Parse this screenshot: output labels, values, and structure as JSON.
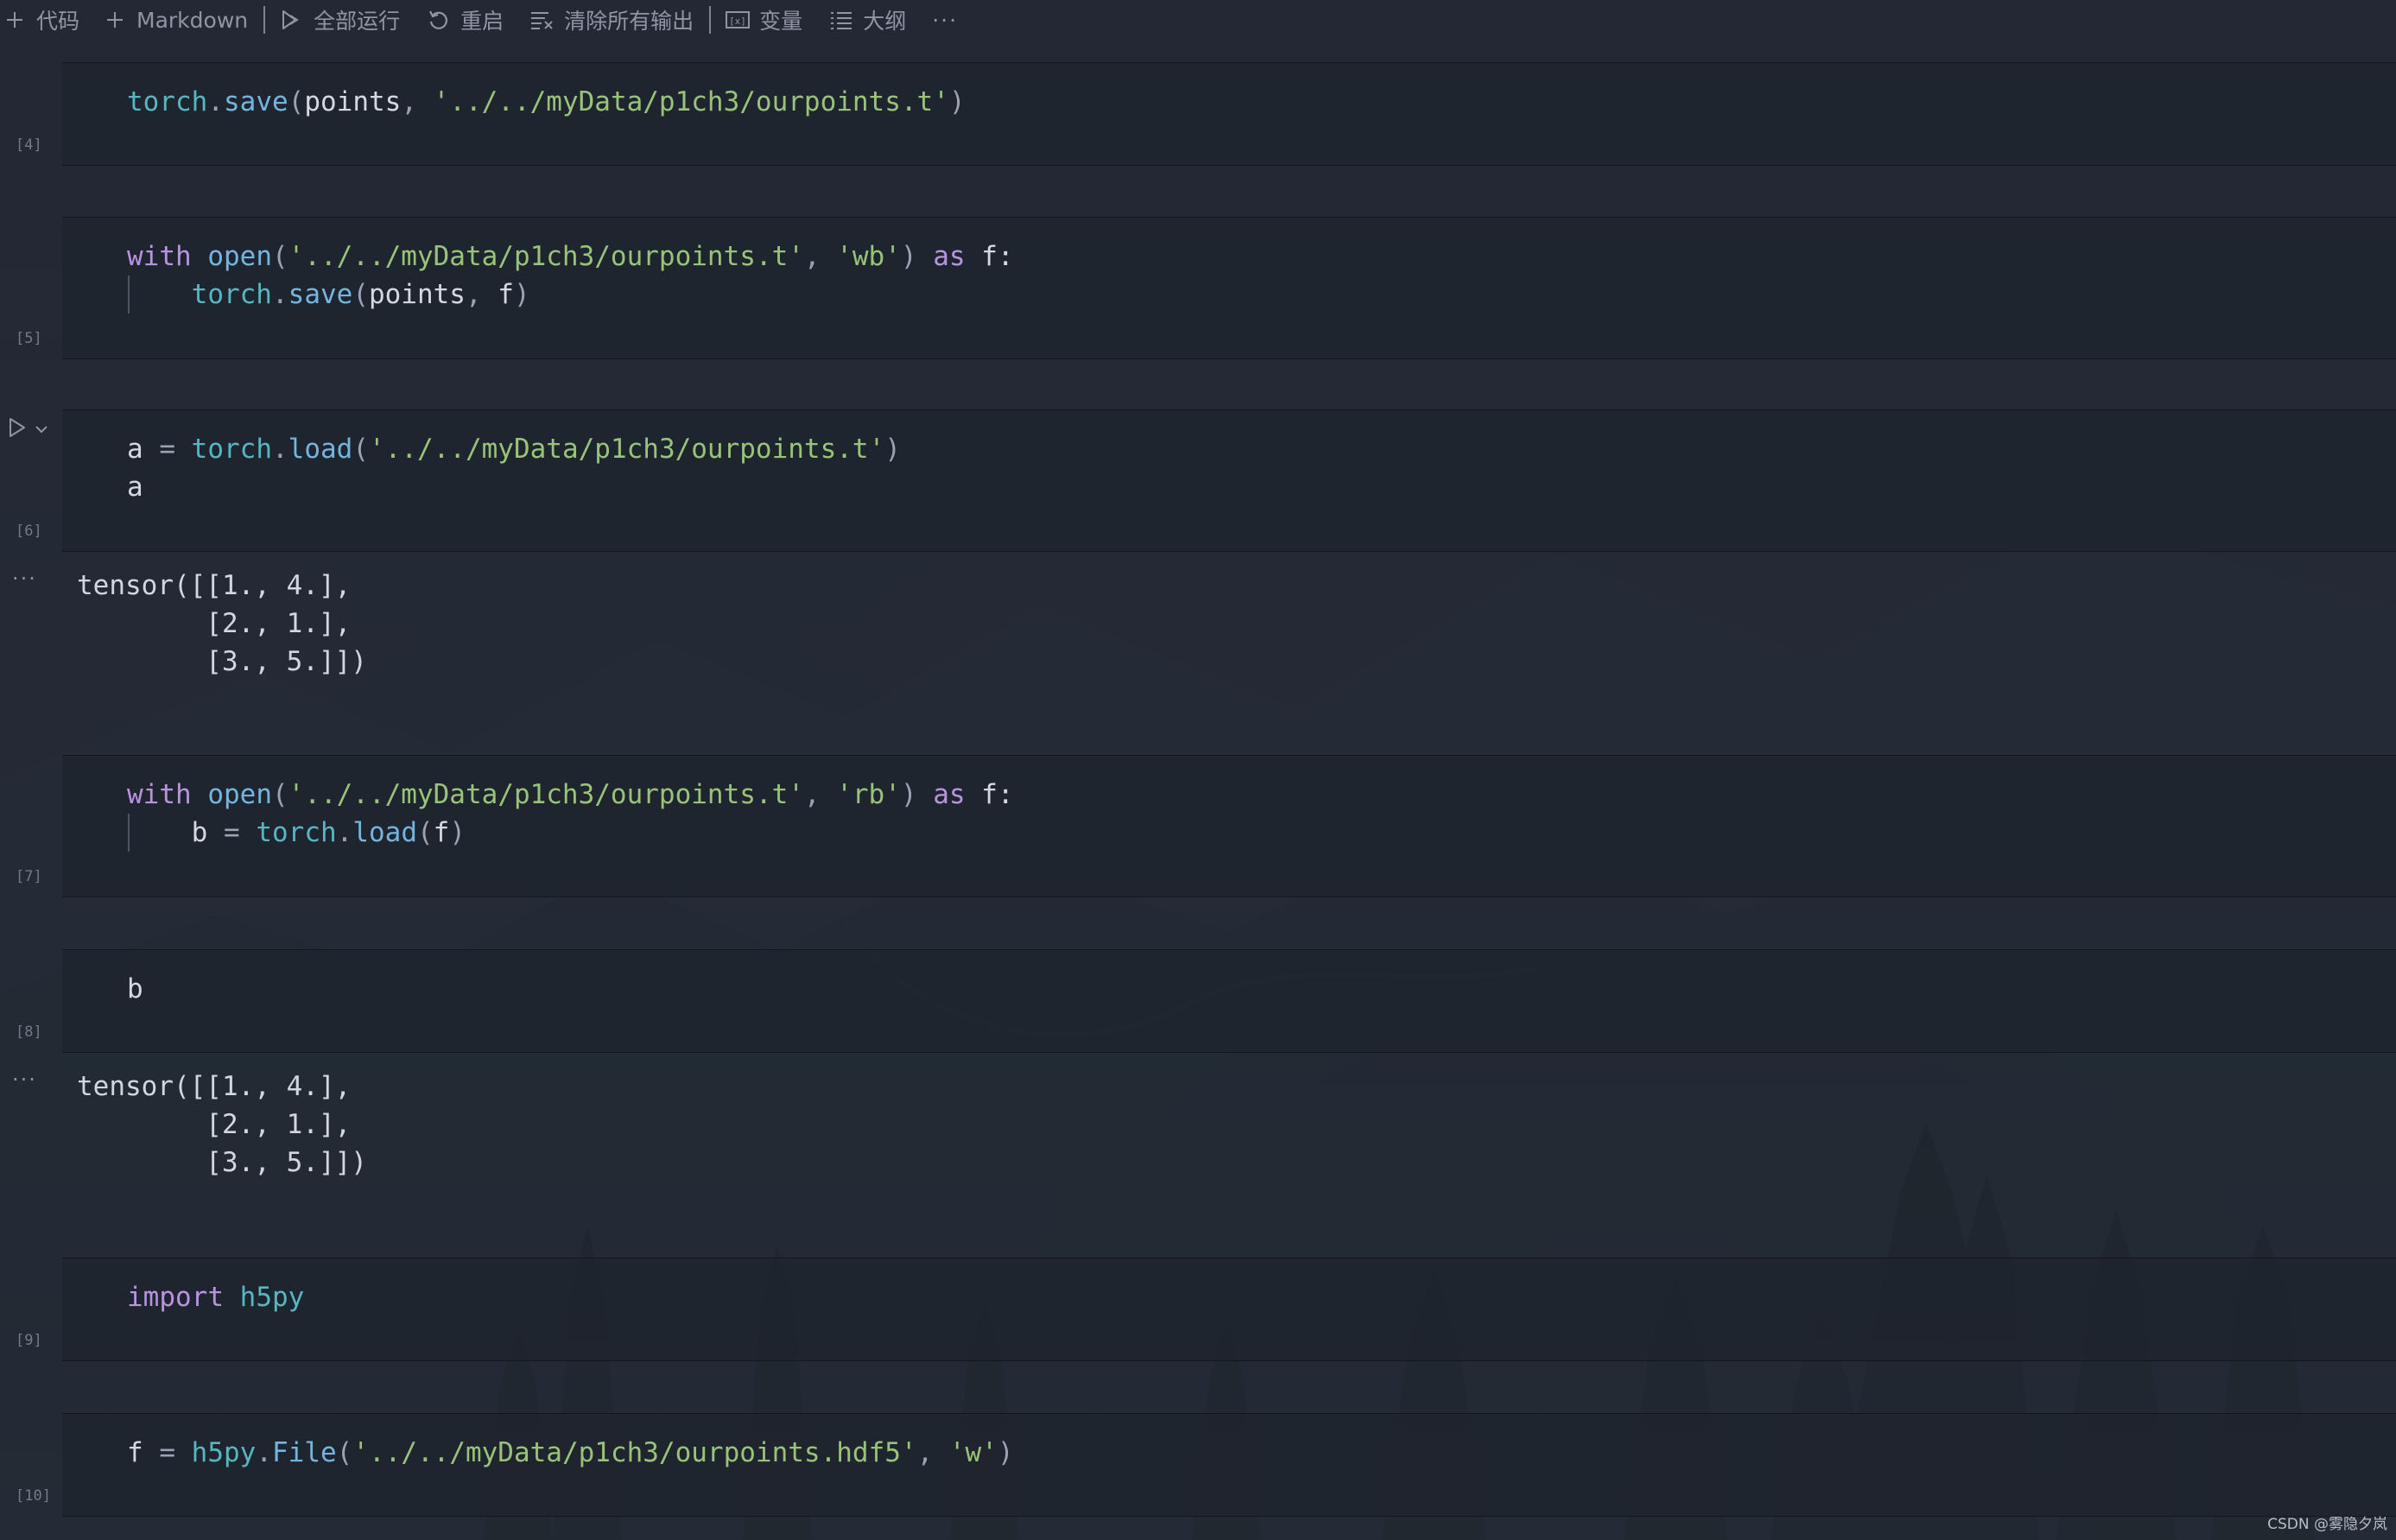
{
  "toolbar": {
    "add_code_label": "代码",
    "add_markdown_label": "Markdown",
    "run_all_label": "全部运行",
    "restart_label": "重启",
    "clear_outputs_label": "清除所有输出",
    "variables_label": "变量",
    "outline_label": "大纲",
    "more_label": "···"
  },
  "cells": [
    {
      "count": "[4]",
      "lines": [
        [
          {
            "t": "torch",
            "k": "mod"
          },
          {
            "t": ".",
            "k": "pun"
          },
          {
            "t": "save",
            "k": "fn"
          },
          {
            "t": "(",
            "k": "pun"
          },
          {
            "t": "points",
            "k": "var"
          },
          {
            "t": ", ",
            "k": "pun"
          },
          {
            "t": "'../../myData/p1ch3/ourpoints.t'",
            "k": "str"
          },
          {
            "t": ")",
            "k": "pun"
          }
        ]
      ]
    },
    {
      "count": "[5]",
      "lines": [
        [
          {
            "t": "with",
            "k": "kw"
          },
          {
            "t": " ",
            "k": "var"
          },
          {
            "t": "open",
            "k": "fn"
          },
          {
            "t": "(",
            "k": "pun"
          },
          {
            "t": "'../../myData/p1ch3/ourpoints.t'",
            "k": "str"
          },
          {
            "t": ", ",
            "k": "pun"
          },
          {
            "t": "'wb'",
            "k": "str"
          },
          {
            "t": ")",
            "k": "pun"
          },
          {
            "t": " as ",
            "k": "kw"
          },
          {
            "t": "f:",
            "k": "var"
          }
        ],
        [
          {
            "t": "    ",
            "k": "var"
          },
          {
            "t": "torch",
            "k": "mod"
          },
          {
            "t": ".",
            "k": "pun"
          },
          {
            "t": "save",
            "k": "fn"
          },
          {
            "t": "(",
            "k": "pun"
          },
          {
            "t": "points",
            "k": "var"
          },
          {
            "t": ", ",
            "k": "pun"
          },
          {
            "t": "f",
            "k": "var"
          },
          {
            "t": ")",
            "k": "pun"
          }
        ]
      ]
    },
    {
      "count": "[6]",
      "lines": [
        [
          {
            "t": "a",
            "k": "var"
          },
          {
            "t": " = ",
            "k": "pun"
          },
          {
            "t": "torch",
            "k": "mod"
          },
          {
            "t": ".",
            "k": "pun"
          },
          {
            "t": "load",
            "k": "fn"
          },
          {
            "t": "(",
            "k": "pun"
          },
          {
            "t": "'../../myData/p1ch3/ourpoints.t'",
            "k": "str"
          },
          {
            "t": ")",
            "k": "pun"
          }
        ],
        [
          {
            "t": "a",
            "k": "var"
          }
        ]
      ],
      "output": [
        "tensor([[1., 4.],",
        "        [2., 1.],",
        "        [3., 5.]])"
      ]
    },
    {
      "count": "[7]",
      "lines": [
        [
          {
            "t": "with",
            "k": "kw"
          },
          {
            "t": " ",
            "k": "var"
          },
          {
            "t": "open",
            "k": "fn"
          },
          {
            "t": "(",
            "k": "pun"
          },
          {
            "t": "'../../myData/p1ch3/ourpoints.t'",
            "k": "str"
          },
          {
            "t": ", ",
            "k": "pun"
          },
          {
            "t": "'rb'",
            "k": "str"
          },
          {
            "t": ")",
            "k": "pun"
          },
          {
            "t": " as ",
            "k": "kw"
          },
          {
            "t": "f:",
            "k": "var"
          }
        ],
        [
          {
            "t": "    ",
            "k": "var"
          },
          {
            "t": "b",
            "k": "var"
          },
          {
            "t": " = ",
            "k": "pun"
          },
          {
            "t": "torch",
            "k": "mod"
          },
          {
            "t": ".",
            "k": "pun"
          },
          {
            "t": "load",
            "k": "fn"
          },
          {
            "t": "(",
            "k": "pun"
          },
          {
            "t": "f",
            "k": "var"
          },
          {
            "t": ")",
            "k": "pun"
          }
        ]
      ]
    },
    {
      "count": "[8]",
      "lines": [
        [
          {
            "t": "b",
            "k": "var"
          }
        ]
      ],
      "output": [
        "tensor([[1., 4.],",
        "        [2., 1.],",
        "        [3., 5.]])"
      ]
    },
    {
      "count": "[9]",
      "lines": [
        [
          {
            "t": "import",
            "k": "kw"
          },
          {
            "t": " ",
            "k": "var"
          },
          {
            "t": "h5py",
            "k": "mod"
          }
        ]
      ]
    },
    {
      "count": "[10]",
      "lines": [
        [
          {
            "t": "f",
            "k": "var"
          },
          {
            "t": " = ",
            "k": "pun"
          },
          {
            "t": "h5py",
            "k": "mod"
          },
          {
            "t": ".",
            "k": "pun"
          },
          {
            "t": "File",
            "k": "fn"
          },
          {
            "t": "(",
            "k": "pun"
          },
          {
            "t": "'../../myData/p1ch3/ourpoints.hdf5'",
            "k": "str"
          },
          {
            "t": ", ",
            "k": "pun"
          },
          {
            "t": "'w'",
            "k": "str"
          },
          {
            "t": ")",
            "k": "pun"
          }
        ]
      ]
    }
  ],
  "output_ellipsis": "···",
  "watermark": "CSDN @雾隐夕岚"
}
